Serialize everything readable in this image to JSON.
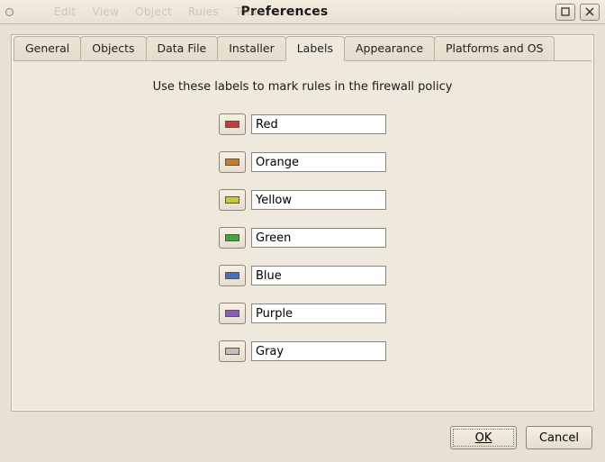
{
  "window": {
    "title": "Preferences",
    "ghost_menu": [
      "Edit",
      "View",
      "Object",
      "Rules",
      "Tools"
    ]
  },
  "tabs": {
    "items": [
      {
        "label": "General"
      },
      {
        "label": "Objects"
      },
      {
        "label": "Data File"
      },
      {
        "label": "Installer"
      },
      {
        "label": "Labels"
      },
      {
        "label": "Appearance"
      },
      {
        "label": "Platforms and OS"
      }
    ],
    "active_index": 4
  },
  "labels_page": {
    "instruction": "Use these labels to mark rules in the firewall policy",
    "rows": [
      {
        "name": "Red",
        "color": "#c43b3b"
      },
      {
        "name": "Orange",
        "color": "#c77b2f"
      },
      {
        "name": "Yellow",
        "color": "#cfc72f"
      },
      {
        "name": "Green",
        "color": "#3da73d"
      },
      {
        "name": "Blue",
        "color": "#4a6fbf"
      },
      {
        "name": "Purple",
        "color": "#8a5cbf"
      },
      {
        "name": "Gray",
        "color": "#bfbfbf"
      }
    ]
  },
  "buttons": {
    "ok": "OK",
    "cancel": "Cancel"
  }
}
